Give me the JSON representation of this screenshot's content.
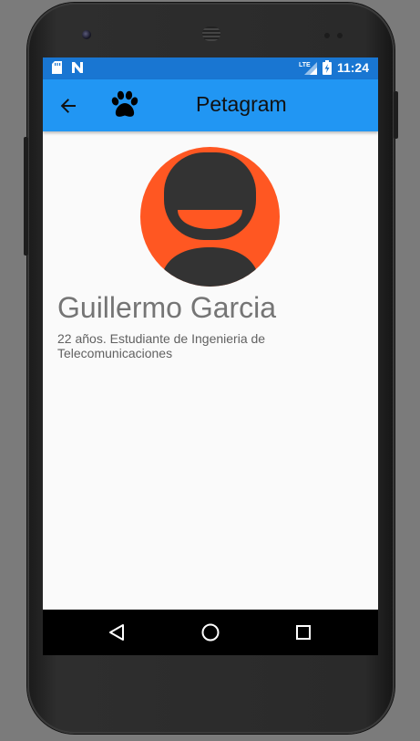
{
  "status_bar": {
    "time": "11:24",
    "left_icons": [
      "sd-card-icon",
      "n-notification-icon"
    ],
    "right_icons": [
      "lte-signal-icon",
      "battery-icon"
    ]
  },
  "app_bar": {
    "title": "Petagram",
    "back_icon": "arrow-back-icon",
    "logo_icon": "paw-icon"
  },
  "profile": {
    "name": "Guillermo Garcia",
    "description": "22 años. Estudiante de Ingenieria de Telecomunicaciones",
    "avatar_icon": "user-avatar-icon"
  },
  "nav_bar": {
    "buttons": [
      "back-triangle-icon",
      "home-circle-icon",
      "recents-square-icon"
    ]
  },
  "colors": {
    "status_bar": "#1976d2",
    "app_bar": "#2196f3",
    "avatar_bg": "#ff5722",
    "avatar_fg": "#333333",
    "name_text": "#757575"
  }
}
